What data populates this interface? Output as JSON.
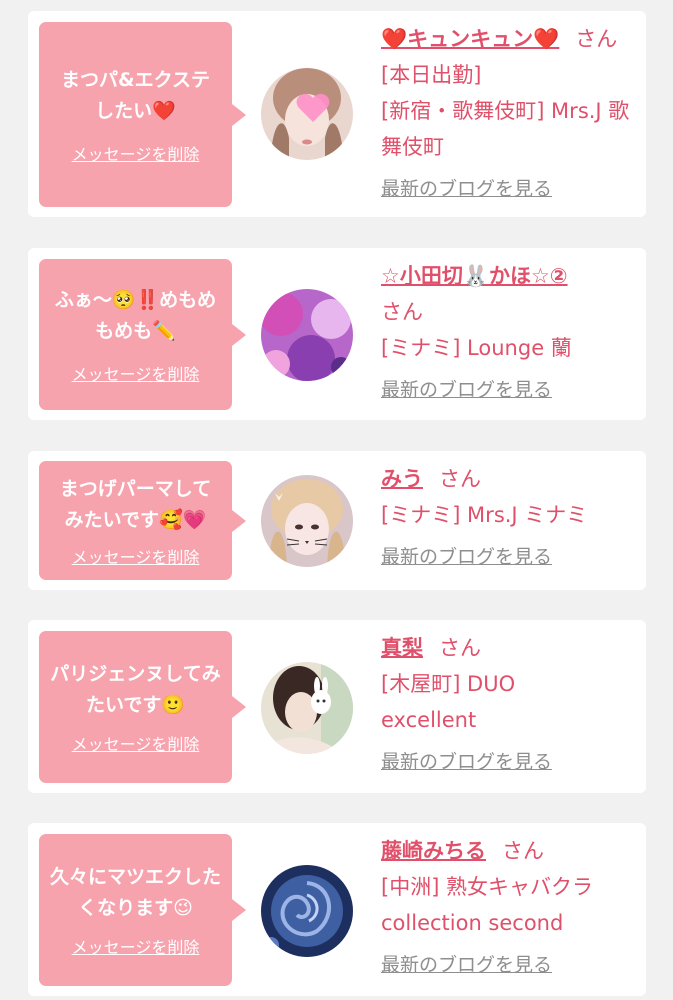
{
  "cards": [
    {
      "message": "まつパ&エクステしたい❤️",
      "delete_label": "メッセージを削除",
      "name": "❤️キュンキュン❤️",
      "suffix": "さん[本日出勤]",
      "shop": "[新宿・歌舞伎町] Mrs.J 歌舞伎町",
      "blog_label": "最新のブログを見る",
      "avatar_icon": "girl-photo-heart-sticker"
    },
    {
      "message": "ふぁ〜🥺‼️めもめもめも✏️",
      "delete_label": "メッセージを削除",
      "name": "☆小田切🐰かほ☆②",
      "suffix": "さん",
      "shop": "[ミナミ] Lounge 蘭",
      "blog_label": "最新のブログを見る",
      "avatar_icon": "purple-floral-photo"
    },
    {
      "message": "まつげパーマしてみたいです🥰💗",
      "delete_label": "メッセージを削除",
      "name": "みう",
      "suffix": "さん",
      "shop": "[ミナミ] Mrs.J ミナミ",
      "blog_label": "最新のブログを見る",
      "avatar_icon": "girl-photo-cat-filter"
    },
    {
      "message": "パリジェンヌしてみたいです🙂",
      "delete_label": "メッセージを削除",
      "name": "真梨",
      "suffix": "さん",
      "shop": "[木屋町] DUO excellent",
      "blog_label": "最新のブログを見る",
      "avatar_icon": "girl-photo-bunny-sticker"
    },
    {
      "message": "久々にマツエクしたくなります😉",
      "delete_label": "メッセージを削除",
      "name": "藤崎みちる",
      "suffix": "さん",
      "shop": "[中洲] 熟女キャバクラ collection second",
      "blog_label": "最新のブログを見る",
      "avatar_icon": "blue-rose-photo"
    }
  ],
  "colors": {
    "bubble": "#f7a3ae",
    "name_text": "#e0506a",
    "link_gray": "#8e8e8e",
    "background": "#f1f1f1"
  }
}
